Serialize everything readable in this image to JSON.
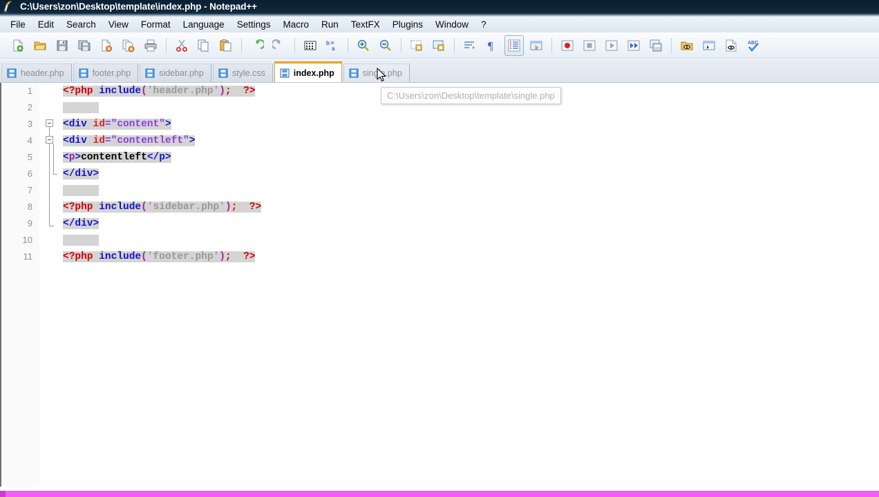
{
  "window": {
    "title": "C:\\Users\\zon\\Desktop\\template\\index.php - Notepad++",
    "app_icon": "notepad-plus-plus-icon"
  },
  "menu": {
    "items": [
      {
        "label": "File"
      },
      {
        "label": "Edit"
      },
      {
        "label": "Search"
      },
      {
        "label": "View"
      },
      {
        "label": "Format"
      },
      {
        "label": "Language"
      },
      {
        "label": "Settings"
      },
      {
        "label": "Macro"
      },
      {
        "label": "Run"
      },
      {
        "label": "TextFX"
      },
      {
        "label": "Plugins"
      },
      {
        "label": "Window"
      },
      {
        "label": "?"
      }
    ]
  },
  "toolbar": {
    "buttons": [
      {
        "name": "new-file-icon"
      },
      {
        "name": "open-file-icon"
      },
      {
        "name": "save-icon"
      },
      {
        "name": "save-all-icon"
      },
      {
        "name": "close-file-icon"
      },
      {
        "name": "close-all-files-icon"
      },
      {
        "name": "print-icon"
      },
      {
        "name": "separator"
      },
      {
        "name": "cut-icon"
      },
      {
        "name": "copy-icon"
      },
      {
        "name": "paste-icon"
      },
      {
        "name": "separator"
      },
      {
        "name": "undo-icon"
      },
      {
        "name": "redo-icon"
      },
      {
        "name": "separator"
      },
      {
        "name": "find-icon"
      },
      {
        "name": "replace-icon"
      },
      {
        "name": "separator"
      },
      {
        "name": "zoom-in-icon"
      },
      {
        "name": "zoom-out-icon"
      },
      {
        "name": "separator"
      },
      {
        "name": "sync-vertical-scroll-icon"
      },
      {
        "name": "sync-horizontal-scroll-icon"
      },
      {
        "name": "separator"
      },
      {
        "name": "word-wrap-icon"
      },
      {
        "name": "show-all-characters-icon"
      },
      {
        "name": "indent-guide-icon"
      },
      {
        "name": "user-defined-dialog-icon"
      },
      {
        "name": "separator"
      },
      {
        "name": "record-macro-icon"
      },
      {
        "name": "stop-macro-icon"
      },
      {
        "name": "play-macro-icon"
      },
      {
        "name": "run-macro-multiple-icon"
      },
      {
        "name": "save-macro-icon"
      },
      {
        "name": "separator"
      },
      {
        "name": "run-icon"
      },
      {
        "name": "console-icon"
      },
      {
        "name": "document-map-icon"
      },
      {
        "name": "spell-check-icon"
      }
    ]
  },
  "tabs": {
    "items": [
      {
        "label": "header.php",
        "active": false
      },
      {
        "label": "footer.php",
        "active": false
      },
      {
        "label": "sidebar.php",
        "active": false
      },
      {
        "label": "style.css",
        "active": false
      },
      {
        "label": "index.php",
        "active": true
      },
      {
        "label": "single.php",
        "active": false,
        "hovered": true
      }
    ]
  },
  "tooltip": {
    "text": "C:\\Users\\zon\\Desktop\\template\\single.php"
  },
  "editor": {
    "line_numbers": [
      "1",
      "2",
      "3",
      "4",
      "5",
      "6",
      "7",
      "8",
      "9",
      "10",
      "11"
    ],
    "lines": [
      {
        "n": "1",
        "text": "<?php include('header.php'); ?>"
      },
      {
        "n": "2",
        "text": ""
      },
      {
        "n": "3",
        "text": "<div id=\"content\">"
      },
      {
        "n": "4",
        "text": "<div id=\"contentleft\">"
      },
      {
        "n": "5",
        "text": "<p>contentleft</p>"
      },
      {
        "n": "6",
        "text": "</div>"
      },
      {
        "n": "7",
        "text": ""
      },
      {
        "n": "8",
        "text": "<?php include('sidebar.php'); ?>"
      },
      {
        "n": "9",
        "text": "</div>"
      },
      {
        "n": "10",
        "text": ""
      },
      {
        "n": "11",
        "text": "<?php include('footer.php'); ?>"
      }
    ],
    "tokens": {
      "php_open": "<?php",
      "php_close": "?>",
      "include": "include",
      "str_header": "'header.php'",
      "str_sidebar": "'sidebar.php'",
      "str_footer": "'footer.php'",
      "paren_open": "(",
      "paren_close": ")",
      "semicolon": ";",
      "space": " ",
      "tag_div_open": "<div",
      "tag_div_close": "</div>",
      "tag_p_open_lt": "<",
      "tag_p_name": "p",
      "tag_p_gt": ">",
      "tag_p_close": "</p>",
      "attr_id": "id",
      "val_content": "=\"content\"",
      "val_contentleft": "=\"contentleft\"",
      "gt": ">",
      "text_contentleft": "contentleft"
    }
  },
  "colors": {
    "titlebar": "#0d2437",
    "accent_tab": "#f0a020",
    "progress": "#f55ef5",
    "php_tag": "#d40000",
    "function": "#1414c8",
    "string": "#9a9a9a",
    "html_tag": "#1414c8",
    "attribute": "#e02020",
    "attr_value": "#8b3fd8",
    "selection_bg": "#d4d4d4",
    "change_marker": "#8ce68c"
  }
}
